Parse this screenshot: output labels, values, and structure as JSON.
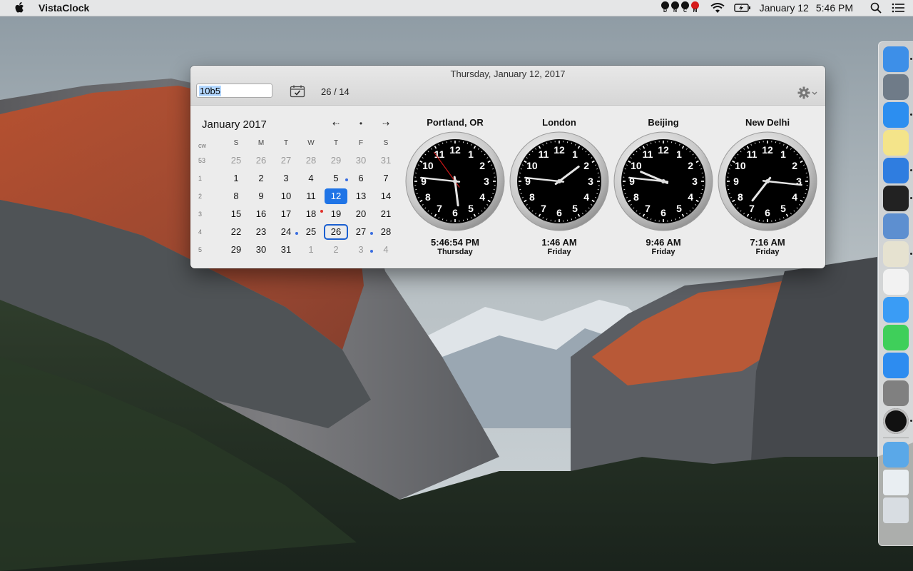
{
  "menubar": {
    "app_name": "VistaClock",
    "dncm": [
      "D",
      "N",
      "C",
      "M"
    ],
    "date": "January 12",
    "time": "5:46 PM"
  },
  "popup": {
    "date_title": "Thursday, January 12, 2017",
    "timezone_input_value": "10b5",
    "week_info": "26 / 14"
  },
  "calendar": {
    "month": "January 2017",
    "nav": {
      "prev": "⇠",
      "today": "•",
      "next": "⇢"
    },
    "week_label": "cw",
    "weekdays": [
      "S",
      "M",
      "T",
      "W",
      "T",
      "F",
      "S"
    ],
    "weeks": [
      {
        "num": "53",
        "days": [
          {
            "d": "25",
            "dim": true
          },
          {
            "d": "26",
            "dim": true
          },
          {
            "d": "27",
            "dim": true
          },
          {
            "d": "28",
            "dim": true
          },
          {
            "d": "29",
            "dim": true
          },
          {
            "d": "30",
            "dim": true
          },
          {
            "d": "31",
            "dim": true
          }
        ]
      },
      {
        "num": "1",
        "days": [
          {
            "d": "1"
          },
          {
            "d": "2"
          },
          {
            "d": "3"
          },
          {
            "d": "4"
          },
          {
            "d": "5",
            "dot": "blue"
          },
          {
            "d": "6"
          },
          {
            "d": "7"
          }
        ]
      },
      {
        "num": "2",
        "days": [
          {
            "d": "8"
          },
          {
            "d": "9"
          },
          {
            "d": "10"
          },
          {
            "d": "11"
          },
          {
            "d": "12",
            "today": true
          },
          {
            "d": "13"
          },
          {
            "d": "14"
          }
        ]
      },
      {
        "num": "3",
        "days": [
          {
            "d": "15"
          },
          {
            "d": "16"
          },
          {
            "d": "17"
          },
          {
            "d": "18",
            "dot": "red"
          },
          {
            "d": "19"
          },
          {
            "d": "20"
          },
          {
            "d": "21"
          }
        ]
      },
      {
        "num": "4",
        "days": [
          {
            "d": "22"
          },
          {
            "d": "23"
          },
          {
            "d": "24",
            "dot": "blue"
          },
          {
            "d": "25"
          },
          {
            "d": "26",
            "selected": true
          },
          {
            "d": "27",
            "dot": "blue"
          },
          {
            "d": "28"
          }
        ]
      },
      {
        "num": "5",
        "days": [
          {
            "d": "29"
          },
          {
            "d": "30"
          },
          {
            "d": "31"
          },
          {
            "d": "1",
            "dim": true
          },
          {
            "d": "2",
            "dim": true
          },
          {
            "d": "3",
            "dim": true,
            "dot": "blue"
          },
          {
            "d": "4",
            "dim": true
          }
        ]
      }
    ]
  },
  "clocks": [
    {
      "city": "Portland, OR",
      "time": "5:46:54 PM",
      "day": "Thursday",
      "hour": 17,
      "minute": 46,
      "second": 54,
      "show_seconds": true
    },
    {
      "city": "London",
      "time": "1:46 AM",
      "day": "Friday",
      "hour": 1,
      "minute": 46
    },
    {
      "city": "Beijing",
      "time": "9:46 AM",
      "day": "Friday",
      "hour": 9,
      "minute": 46
    },
    {
      "city": "New Delhi",
      "time": "7:16 AM",
      "day": "Friday",
      "hour": 7,
      "minute": 16
    }
  ],
  "dock": {
    "apps": [
      {
        "name": "finder",
        "color": "#3d8fe8",
        "running": true
      },
      {
        "name": "launchpad",
        "color": "#6f7b88",
        "running": false
      },
      {
        "name": "safari",
        "color": "#2c8ef0",
        "running": true
      },
      {
        "name": "notes",
        "color": "#f4e48a",
        "running": false
      },
      {
        "name": "xcode",
        "color": "#2f7de0",
        "running": true
      },
      {
        "name": "terminal",
        "color": "#222222",
        "running": true
      },
      {
        "name": "preview",
        "color": "#5d8fd0",
        "running": false
      },
      {
        "name": "clock-settings",
        "color": "#e6e2d0",
        "running": true
      },
      {
        "name": "photos",
        "color": "#f2f2f2",
        "running": false
      },
      {
        "name": "messages",
        "color": "#3a9cf5",
        "running": false
      },
      {
        "name": "facetime",
        "color": "#3fcf5a",
        "running": false
      },
      {
        "name": "app-store",
        "color": "#2d8cf0",
        "running": false
      },
      {
        "name": "system-preferences",
        "color": "#808080",
        "running": false
      },
      {
        "name": "vistaclock",
        "color": "#111111",
        "running": true
      },
      {
        "name": "downloads",
        "color": "#5aa8e8",
        "running": false
      },
      {
        "name": "documents-stack",
        "color": "#e9eef2",
        "running": false
      },
      {
        "name": "trash",
        "color": "#d8dde2",
        "running": false
      }
    ]
  }
}
